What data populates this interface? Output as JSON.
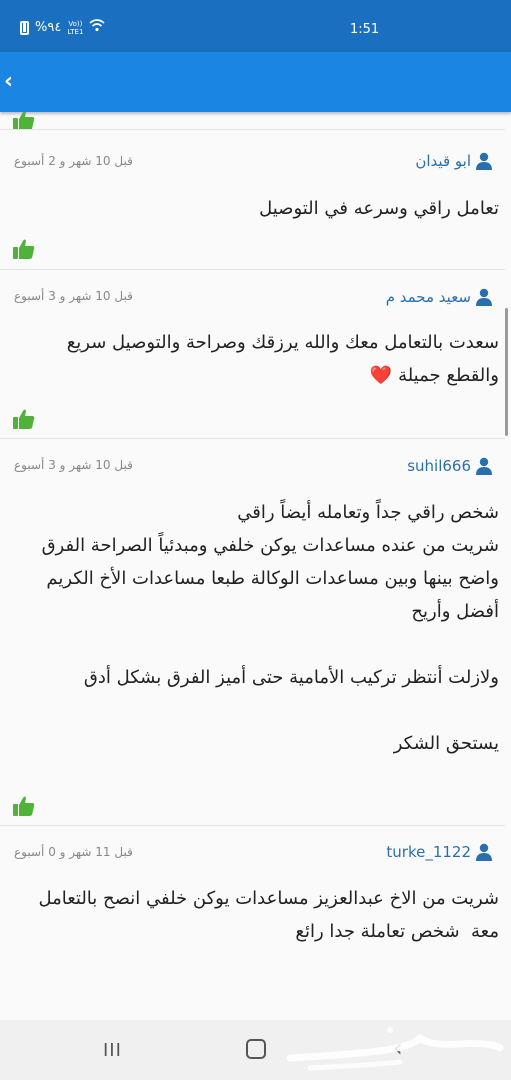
{
  "status_bar": {
    "time": "1:51",
    "battery": "%٩٤",
    "network": "Vo)) LTE1",
    "icons": [
      "battery-icon",
      "volte-icon",
      "wifi-icon"
    ]
  },
  "app_bar": {
    "back_icon": "chevron-left-icon"
  },
  "reviews": [
    {
      "user": "ابو قيدان",
      "time": "قبل 10 شهر و 2 أسبوع",
      "text": "تعامل راقي وسرعه في التوصيل"
    },
    {
      "user": "سعيد محمد م",
      "time": "قبل 10 شهر و 3 أسبوع",
      "text": "سعدت بالتعامل معك والله يرزقك وصراحة والتوصيل سريع والقطع جميلة",
      "emoji": "❤️"
    },
    {
      "user": "suhil666",
      "time": "قبل 10 شهر و 3 أسبوع",
      "text": "شخص راقي جداً وتعامله أيضاً راقي\nشريت من عنده مساعدات يوكن خلفي ومبدئياً الصراحة الفرق واضح بينها وبين مساعدات الوكالة طبعا مساعدات الأخ الكريم أفضل وأريح\n\nولازلت أنتظر تركيب الأمامية حتى أميز الفرق بشكل أدق\n\nيستحق الشكر"
    },
    {
      "user": "turke_1122",
      "time": "قبل 11 شهر و 0 أسبوع",
      "text": "شريت من الاخ عبدالعزيز مساعدات يوكن خلفي انصح بالتعامل معة  شخص تعاملة جدا رائع"
    }
  ],
  "icons": {
    "thumb": "thumbs-up-icon",
    "user": "user-icon"
  },
  "colors": {
    "status_bar": "#1a6fc1",
    "app_bar": "#1a85e3",
    "username": "#2a6fad",
    "thumb": "#4fb33a",
    "heart": "#e0101d"
  },
  "watermark": "حراج"
}
